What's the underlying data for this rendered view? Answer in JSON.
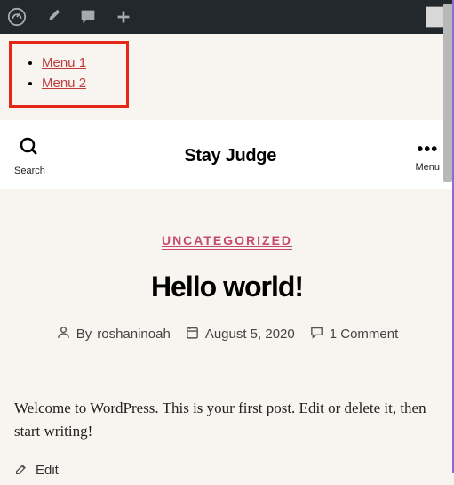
{
  "admin_bar": {
    "icons": [
      "dashboard-icon",
      "brush-icon",
      "comment-icon",
      "plus-icon"
    ]
  },
  "highlighted_menu": {
    "items": [
      "Menu 1",
      "Menu 2"
    ]
  },
  "header": {
    "search_label": "Search",
    "site_title": "Stay Judge",
    "menu_label": "Menu"
  },
  "post": {
    "category": "UNCATEGORIZED",
    "title": "Hello world!",
    "by_prefix": "By",
    "author": "roshaninoah",
    "date": "August 5, 2020",
    "comments": "1 Comment",
    "body": "Welcome to WordPress. This is your first post. Edit or delete it, then start writing!",
    "edit_label": "Edit"
  }
}
